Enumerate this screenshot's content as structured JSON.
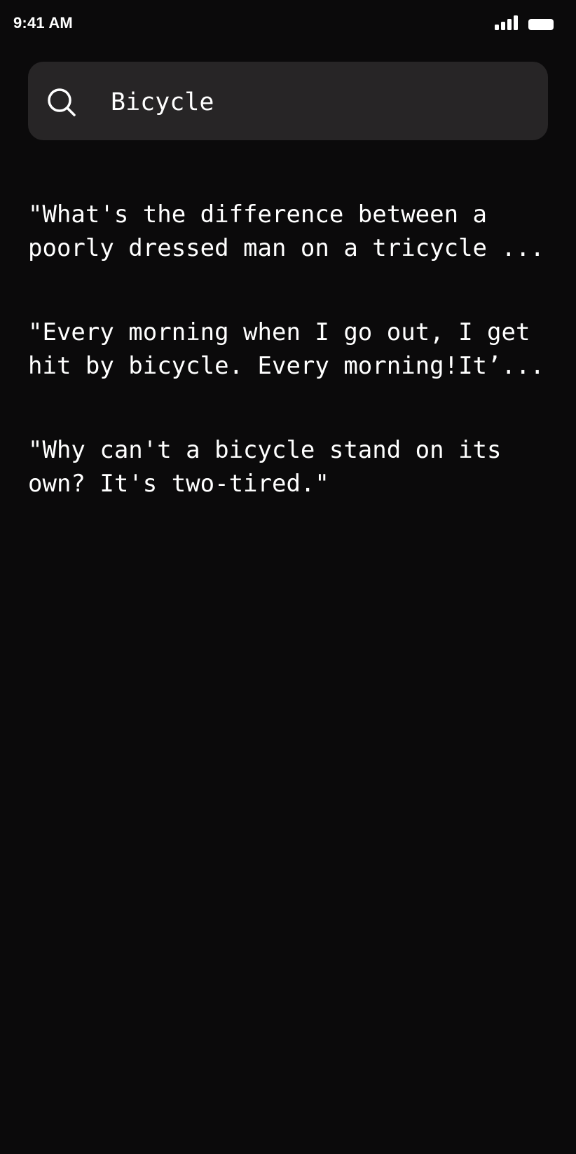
{
  "status_bar": {
    "time": "9:41 AM",
    "signal_icon": "cellular-signal-icon",
    "battery_icon": "battery-icon",
    "colors": {
      "foreground": "#ffffff"
    }
  },
  "search": {
    "icon": "search-icon",
    "value": "Bicycle",
    "colors": {
      "background": "#272526",
      "text": "#ffffff"
    }
  },
  "results": [
    {
      "text": "\"What's the difference between a\npoorly dressed man on a tricycle ..."
    },
    {
      "text": "\"Every morning when I go out, I get\nhit by bicycle. Every morning!It’..."
    },
    {
      "text": "\"Why can't a bicycle stand on its\nown? It's two-tired.\""
    }
  ],
  "theme": {
    "background": "#0b0a0b",
    "text": "#ffffff"
  }
}
